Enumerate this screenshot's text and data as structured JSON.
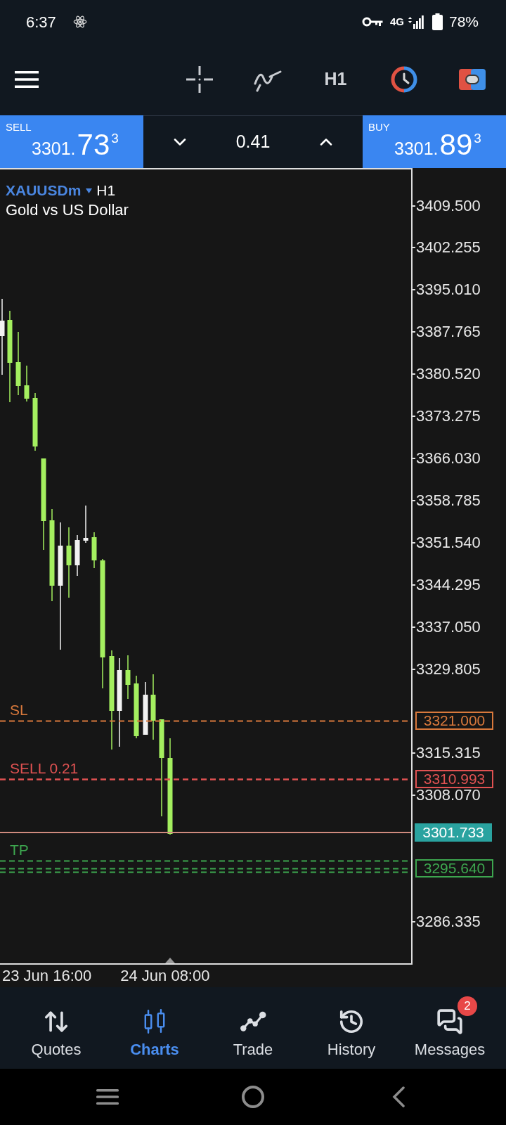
{
  "status_bar": {
    "time": "6:37",
    "network": "4G",
    "battery": "78%"
  },
  "toolbar": {
    "timeframe": "H1"
  },
  "quote_bar": {
    "sell": {
      "label": "SELL",
      "price": "3301.",
      "big_digits": "73",
      "superscript": "3"
    },
    "volume": "0.41",
    "buy": {
      "label": "BUY",
      "price": "3301.",
      "big_digits": "89",
      "superscript": "3"
    }
  },
  "chart": {
    "symbol": "XAUUSDm",
    "timeframe": "H1",
    "description": "Gold vs US Dollar",
    "price_axis": [
      "3409.500",
      "3402.255",
      "3395.010",
      "3387.765",
      "3380.520",
      "3373.275",
      "3366.030",
      "3358.785",
      "3351.540",
      "3344.295",
      "3337.050",
      "3329.805",
      "3315.315",
      "3308.070",
      "3286.335"
    ],
    "order_lines": [
      {
        "kind": "stop_loss",
        "label": "SL",
        "tag": "3321.000",
        "color": "#d9793c"
      },
      {
        "kind": "position",
        "label": "SELL 0.21",
        "tag": "3310.993",
        "color": "#e05252"
      },
      {
        "kind": "bid",
        "tag": "3301.733",
        "color": "#2aa3a0"
      },
      {
        "kind": "take_profit",
        "label": "TP",
        "color": "#3da64f"
      },
      {
        "kind": "take_profit",
        "tag": "3295.640",
        "color": "#3da64f"
      },
      {
        "kind": "take_profit",
        "color": "#3da64f"
      }
    ],
    "time_axis": [
      "23 Jun 16:00",
      "24 Jun 08:00"
    ]
  },
  "bottom_nav": [
    {
      "label": "Quotes",
      "selected": false
    },
    {
      "label": "Charts",
      "selected": true
    },
    {
      "label": "Trade",
      "selected": false
    },
    {
      "label": "History",
      "selected": false
    },
    {
      "label": "Messages",
      "selected": false,
      "badge": "2"
    }
  ]
}
